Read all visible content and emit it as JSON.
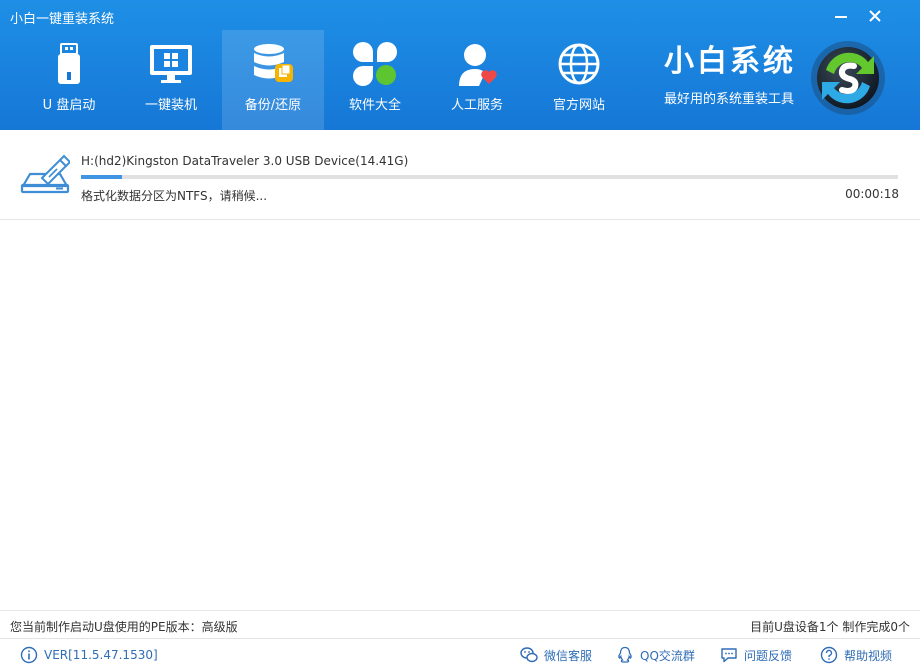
{
  "app": {
    "title": "小白一键重装系统"
  },
  "window": {
    "minimize_icon": "minimize-icon",
    "close_icon": "close-icon"
  },
  "nav": {
    "items": [
      {
        "label": "U 盘启动",
        "icon": "usb-drive-icon",
        "active": false
      },
      {
        "label": "一键装机",
        "icon": "monitor-windows-icon",
        "active": false
      },
      {
        "label": "备份/还原",
        "icon": "database-backup-icon",
        "active": true
      },
      {
        "label": "软件大全",
        "icon": "apps-clover-icon",
        "active": false
      },
      {
        "label": "人工服务",
        "icon": "user-heart-icon",
        "active": false
      },
      {
        "label": "官方网站",
        "icon": "globe-icon",
        "active": false
      }
    ]
  },
  "brand": {
    "name": "小白系统",
    "slogan": "最好用的系统重装工具",
    "logo_icon": "refresh-globe-logo"
  },
  "device": {
    "name": "H:(hd2)Kingston DataTraveler 3.0 USB Device(14.41G)",
    "status": "格式化数据分区为NTFS，请稍候...",
    "elapsed": "00:00:18",
    "progress": 0.05,
    "icon": "usb-device-icon"
  },
  "status_bar": {
    "pe_version": "您当前制作启动U盘使用的PE版本：高级版",
    "device_count": "目前U盘设备1个 制作完成0个"
  },
  "footer": {
    "version": "VER[11.5.47.1530]",
    "wechat": "微信客服",
    "qq": "QQ交流群",
    "feedback": "问题反馈",
    "help": "帮助视频"
  },
  "colors": {
    "header": "#1a84e0",
    "accent": "#3f95e3",
    "link": "#2f6db6"
  }
}
